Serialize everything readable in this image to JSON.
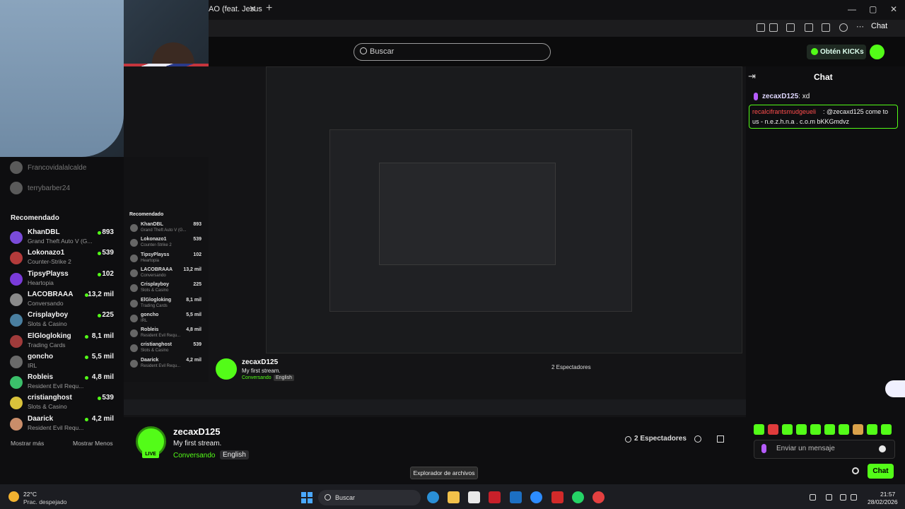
{
  "browser": {
    "tab_title": "AO (feat. Jesus",
    "tab_close": "✕",
    "new_tab": "+",
    "window_controls": [
      "—",
      "▢",
      "✕"
    ],
    "chat_button": "Chat"
  },
  "header": {
    "search_placeholder": "Buscar",
    "kicks_button": "Obtén KICKs"
  },
  "sidebar": {
    "following": [
      {
        "name": "Francovidalalcalde"
      },
      {
        "name": "terrybarber24"
      }
    ],
    "recommended_title": "Recomendado",
    "recommended": [
      {
        "name": "KhanDBL",
        "category": "Grand Theft Auto V (G...",
        "viewers": "893",
        "color": "#7a4bd9"
      },
      {
        "name": "Lokonazo1",
        "category": "Counter-Strike 2",
        "viewers": "539",
        "color": "#b33b3b"
      },
      {
        "name": "TipsyPlayss",
        "category": "Heartopia",
        "viewers": "102",
        "color": "#7a3bd9"
      },
      {
        "name": "LACOBRAAA",
        "category": "Conversando",
        "viewers": "13,2 mil",
        "color": "#8a8a8a"
      },
      {
        "name": "Crisplayboy",
        "category": "Slots & Casino",
        "viewers": "225",
        "color": "#4a7fa0"
      },
      {
        "name": "ElGlogloking",
        "category": "Trading Cards",
        "viewers": "8,1 mil",
        "color": "#a03b3b"
      },
      {
        "name": "goncho",
        "category": "IRL",
        "viewers": "5,5 mil",
        "color": "#6a6a6a"
      },
      {
        "name": "Robleis",
        "category": "Resident Evil Requ...",
        "viewers": "4,8 mil",
        "color": "#3bbf6a"
      },
      {
        "name": "cristianghost",
        "category": "Slots & Casino",
        "viewers": "539",
        "color": "#d9c23b"
      },
      {
        "name": "Daarick",
        "category": "Resident Evil Requ...",
        "viewers": "4,2 mil",
        "color": "#c98d6a"
      }
    ],
    "show_more": "Mostrar más",
    "show_less": "Mostrar Menos"
  },
  "chat": {
    "title": "Chat",
    "messages": [
      {
        "user": "zecaxD125",
        "text": ": xd"
      },
      {
        "user": "recalcifrantsmudgeueli",
        "text": ": @zecaxd125 come to",
        "text2": "us - n.e.z.h.n.a . c.o.m bKKGmdvz"
      }
    ],
    "input_placeholder": "Enviar un mensaje",
    "send_button": "Chat"
  },
  "stream": {
    "streamer": "zecaxD125",
    "title": "My first stream.",
    "category": "Conversando",
    "language": "English",
    "live_badge": "LIVE",
    "viewers": "2 Espectadores"
  },
  "nested": {
    "streamer": "zecaxD125",
    "title": "My first stream.",
    "category": "Conversando",
    "language": "English",
    "viewers": "2 Espectadores",
    "recommended_title": "Recomendado",
    "items": [
      {
        "name": "KhanDBL",
        "cat": "Grand Theft Auto V (G...",
        "count": "893"
      },
      {
        "name": "Lokonazo1",
        "cat": "Counter-Strike 2",
        "count": "539"
      },
      {
        "name": "TipsyPlayss",
        "cat": "Heartopia",
        "count": "102"
      },
      {
        "name": "LACOBRAAA",
        "cat": "Conversando",
        "count": "13,2 mil"
      },
      {
        "name": "Crisplayboy",
        "cat": "Slots & Casino",
        "count": "225"
      },
      {
        "name": "ElGlogloking",
        "cat": "Trading Cards",
        "count": "8,1 mil"
      },
      {
        "name": "goncho",
        "cat": "IRL",
        "count": "5,5 mil"
      },
      {
        "name": "Robleis",
        "cat": "Resident Evil Requ...",
        "count": "4,8 mil"
      },
      {
        "name": "cristianghost",
        "cat": "Slots & Casino",
        "count": "539"
      },
      {
        "name": "Daarick",
        "cat": "Resident Evil Requ...",
        "count": "4,2 mil"
      }
    ]
  },
  "tooltip": "Explorador de archivos",
  "taskbar": {
    "weather_temp": "22°C",
    "weather_desc": "Prac. despejado",
    "search_text": "Buscar",
    "time": "21:57",
    "date": "28/02/2026",
    "apps": [
      "edge",
      "files",
      "store",
      "mcafee",
      "outlook",
      "zoom",
      "lexicon",
      "whatsapp",
      "chrome"
    ]
  },
  "colors": {
    "kick_green": "#53fc18",
    "accent_purple": "#b65cff",
    "background": "#0b0b0c"
  }
}
